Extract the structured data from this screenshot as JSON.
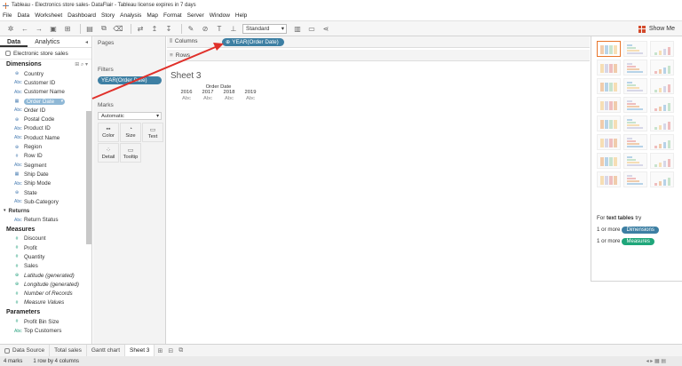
{
  "window": {
    "title": "Tableau - Electronics store sales- DataFlair - Tableau license expires in 7 days"
  },
  "menu": [
    "File",
    "Data",
    "Worksheet",
    "Dashboard",
    "Story",
    "Analysis",
    "Map",
    "Format",
    "Server",
    "Window",
    "Help"
  ],
  "toolbar": {
    "fit_select": "Standard",
    "show_me": "Show Me"
  },
  "data_panel": {
    "tabs": [
      "Data",
      "Analytics"
    ],
    "datasource": "Electronic store sales",
    "dimensions_title": "Dimensions",
    "dimensions": [
      {
        "icon": "globe-icon",
        "glyph": "⊕",
        "label": "Country"
      },
      {
        "icon": "abc-icon",
        "glyph": "Abc",
        "label": "Customer ID"
      },
      {
        "icon": "abc-icon",
        "glyph": "Abc",
        "label": "Customer Name"
      },
      {
        "icon": "calendar-icon",
        "glyph": "▦",
        "label": "Order Date"
      },
      {
        "icon": "abc-icon",
        "glyph": "Abc",
        "label": "Order ID"
      },
      {
        "icon": "globe-icon",
        "glyph": "⊕",
        "label": "Postal Code"
      },
      {
        "icon": "abc-icon",
        "glyph": "Abc",
        "label": "Product ID"
      },
      {
        "icon": "abc-icon",
        "glyph": "Abc",
        "label": "Product Name"
      },
      {
        "icon": "globe-icon",
        "glyph": "⊕",
        "label": "Region"
      },
      {
        "icon": "number-icon",
        "glyph": "#",
        "label": "Row ID"
      },
      {
        "icon": "abc-icon",
        "glyph": "Abc",
        "label": "Segment"
      },
      {
        "icon": "calendar-icon",
        "glyph": "▦",
        "label": "Ship Date"
      },
      {
        "icon": "abc-icon",
        "glyph": "Abc",
        "label": "Ship Mode"
      },
      {
        "icon": "globe-icon",
        "glyph": "⊕",
        "label": "State"
      },
      {
        "icon": "abc-icon",
        "glyph": "Abc",
        "label": "Sub-Category"
      }
    ],
    "returns_group": "Returns",
    "returns_fields": [
      {
        "icon": "abc-icon",
        "glyph": "Abc",
        "label": "Return Status"
      }
    ],
    "measures_title": "Measures",
    "measures": [
      {
        "icon": "number-icon",
        "glyph": "#",
        "label": "Discount"
      },
      {
        "icon": "number-icon",
        "glyph": "#",
        "label": "Profit"
      },
      {
        "icon": "number-icon",
        "glyph": "#",
        "label": "Quantity"
      },
      {
        "icon": "number-icon",
        "glyph": "#",
        "label": "Sales"
      },
      {
        "icon": "globe-icon",
        "glyph": "⊕",
        "label": "Latitude (generated)",
        "italic": true
      },
      {
        "icon": "globe-icon",
        "glyph": "⊕",
        "label": "Longitude (generated)",
        "italic": true
      },
      {
        "icon": "number-icon",
        "glyph": "#",
        "label": "Number of Records",
        "italic": true
      },
      {
        "icon": "number-icon",
        "glyph": "#",
        "label": "Measure Values",
        "italic": true
      }
    ],
    "parameters_title": "Parameters",
    "parameters": [
      {
        "icon": "number-icon",
        "glyph": "#",
        "label": "Profit Bin Size"
      },
      {
        "icon": "abc-icon",
        "glyph": "Abc",
        "label": "Top Customers"
      }
    ]
  },
  "shelves": {
    "pages_title": "Pages",
    "filters_title": "Filters",
    "filter_pill": "YEAR(Order Date)",
    "marks_title": "Marks",
    "marks_type": "Automatic",
    "mark_buttons": [
      {
        "name": "color-button",
        "icon": "color-icon",
        "glyph": "▪▪",
        "label": "Color"
      },
      {
        "name": "size-button",
        "icon": "size-icon",
        "glyph": "◔",
        "label": "Size"
      },
      {
        "name": "text-button",
        "icon": "text-icon",
        "glyph": "▭",
        "label": "Text"
      },
      {
        "name": "detail-button",
        "icon": "detail-icon",
        "glyph": "⁘",
        "label": "Detail"
      },
      {
        "name": "tooltip-button",
        "icon": "tooltip-icon",
        "glyph": "▭",
        "label": "Tooltip"
      }
    ]
  },
  "canvas": {
    "columns_label": "Columns",
    "rows_label": "Rows",
    "column_pill": "YEAR(Order Date)",
    "sheet_title": "Sheet 3",
    "header": "Order Date",
    "years": [
      "2016",
      "2017",
      "2018",
      "2019"
    ],
    "cells": [
      "Abc",
      "Abc",
      "Abc",
      "Abc"
    ]
  },
  "show_me": {
    "hint_prefix": "For",
    "hint_bold": "text tables",
    "hint_suffix": "try",
    "line1_prefix": "1 or more",
    "line1_badge": "Dimensions",
    "line2_prefix": "1 or more",
    "line2_badge": "Measures"
  },
  "bottom_tabs": {
    "datasource": "Data Source",
    "sheets": [
      "Total sales",
      "Gantt chart",
      "Sheet 3"
    ],
    "active": "Sheet 3"
  },
  "status": {
    "marks": "4 marks",
    "dims": "1 row by 4 columns"
  },
  "colors": {
    "pill_blue": "#3d7fa3",
    "measure_green": "#1fa67a",
    "arrow_red": "#e0302a",
    "active_orange": "#e8762c"
  }
}
